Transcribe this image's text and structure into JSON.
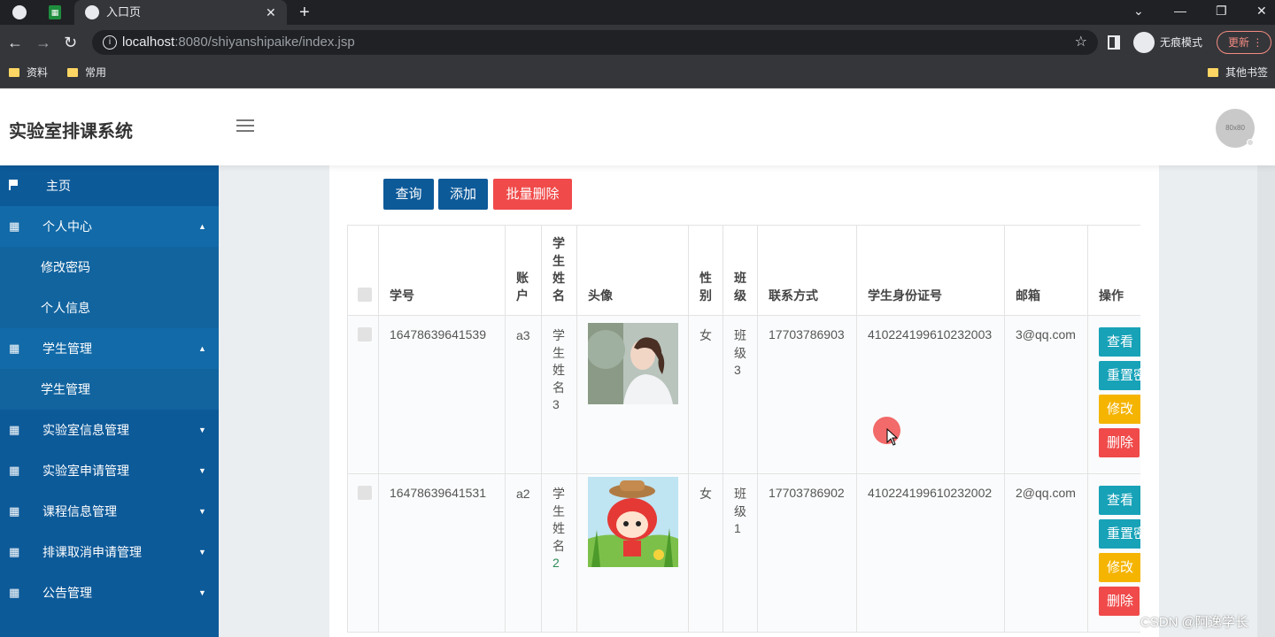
{
  "browser": {
    "tab_title": "入口页",
    "url_host": "localhost",
    "url_path": ":8080/shiyanshipaike/index.jsp",
    "incognito_label": "无痕模式",
    "update_label": "更新",
    "bookmarks": [
      "资料",
      "常用"
    ],
    "other_bookmarks": "其他书签"
  },
  "app": {
    "title": "实验室排课系统",
    "avatar_text": "80x80"
  },
  "sidebar": {
    "items": [
      {
        "label": "主页"
      },
      {
        "label": "个人中心"
      },
      {
        "label": "修改密码"
      },
      {
        "label": "个人信息"
      },
      {
        "label": "学生管理"
      },
      {
        "label": "学生管理"
      },
      {
        "label": "实验室信息管理"
      },
      {
        "label": "实验室申请管理"
      },
      {
        "label": "课程信息管理"
      },
      {
        "label": "排课取消申请管理"
      },
      {
        "label": "公告管理"
      }
    ]
  },
  "toolbar": {
    "query": "查询",
    "add": "添加",
    "batch_delete": "批量删除"
  },
  "table": {
    "headers": [
      "学号",
      "账户",
      "学生姓名",
      "头像",
      "性别",
      "班级",
      "联系方式",
      "学生身份证号",
      "邮箱",
      "操作"
    ],
    "rows": [
      {
        "id": "16478639641539",
        "account": "a3",
        "name_prefix": "学生姓名",
        "name_num": "3",
        "gender": "女",
        "class_prefix": "班级",
        "class_num": "3",
        "phone": "17703786903",
        "id_card": "410224199610232003",
        "email": "3@qq.com"
      },
      {
        "id": "16478639641531",
        "account": "a2",
        "name_prefix": "学生姓名",
        "name_num": "2",
        "gender": "女",
        "class_prefix": "班级",
        "class_num": "1",
        "phone": "17703786902",
        "id_card": "410224199610232002",
        "email": "2@qq.com"
      }
    ],
    "actions": {
      "view": "查看",
      "reset": "重置密码",
      "edit": "修改",
      "delete": "删除"
    }
  },
  "watermark": "CSDN @阿逸学长"
}
